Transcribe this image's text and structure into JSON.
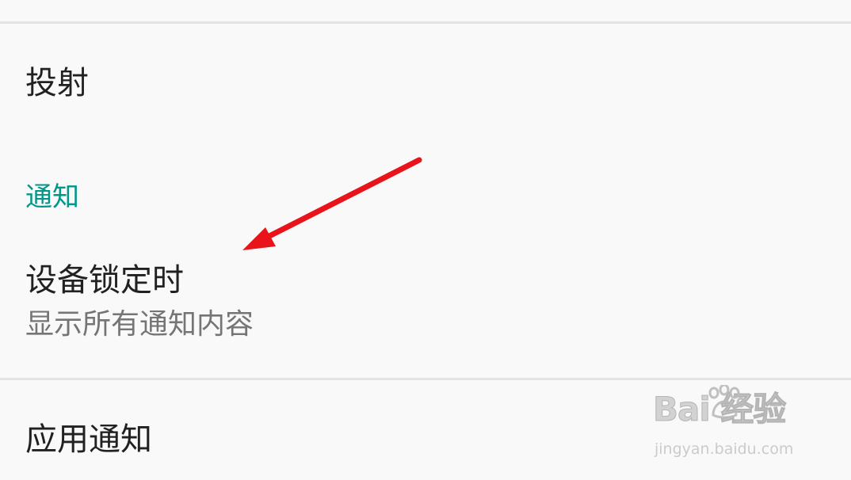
{
  "settings": {
    "items": [
      {
        "title": "投射"
      },
      {
        "title": "设备锁定时",
        "summary": "显示所有通知内容"
      },
      {
        "title": "应用通知"
      }
    ],
    "sections": [
      {
        "header": "通知"
      }
    ]
  },
  "watermark": {
    "logo_text": "Bai 经验",
    "url": "jingyan.baidu.com"
  },
  "colors": {
    "background": "#f9f9f9",
    "divider": "#e3e3e3",
    "title_text": "#212121",
    "summary_text": "#757575",
    "section_accent": "#009688",
    "annotation_arrow": "#e8141a"
  }
}
